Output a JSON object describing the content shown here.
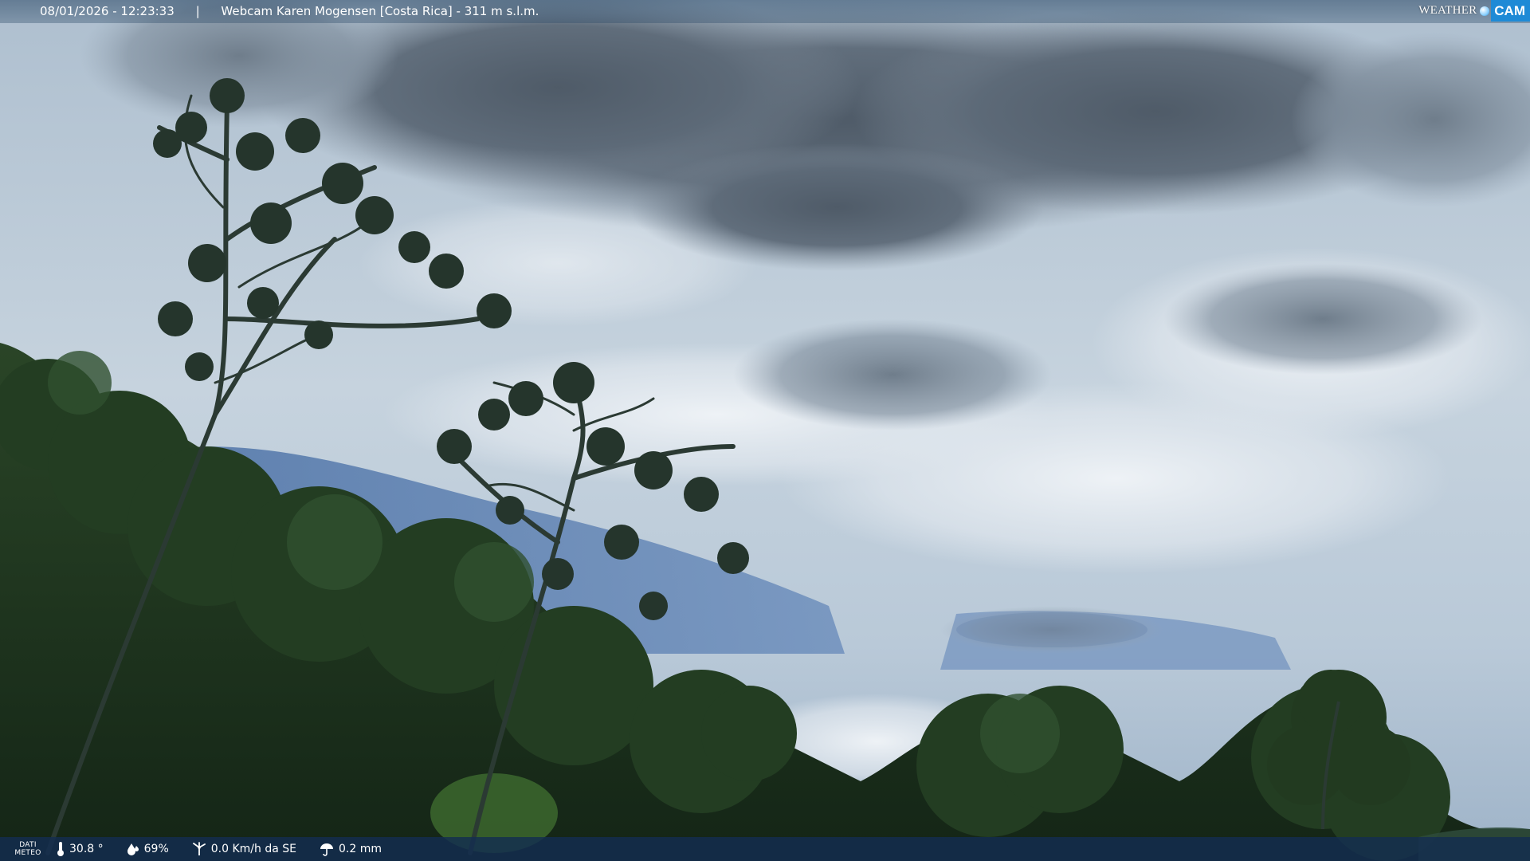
{
  "header": {
    "datetime": "08/01/2026 - 12:23:33",
    "separator": "|",
    "title": "Webcam Karen Mogensen [Costa Rica] - 311 m s.l.m."
  },
  "logo": {
    "word_weather": "WEATHER",
    "word_cam": "CAM",
    "color_cam_bg": "#1e8ad6"
  },
  "weather_bar": {
    "label_line1": "DATI",
    "label_line2": "METEO",
    "temperature": {
      "icon": "thermometer-icon",
      "value": "30.8 °"
    },
    "humidity": {
      "icon": "humidity-drop-icon",
      "value": "69%"
    },
    "wind": {
      "icon": "wind-icon",
      "value": "0.0 Km/h da SE"
    },
    "rain": {
      "icon": "rain-umbrella-icon",
      "value": "0.2 mm"
    }
  },
  "scene": {
    "sky_color": "#9fb6cb",
    "cloud_color": "#5d6a78",
    "foliage_color": "#1e3320"
  }
}
